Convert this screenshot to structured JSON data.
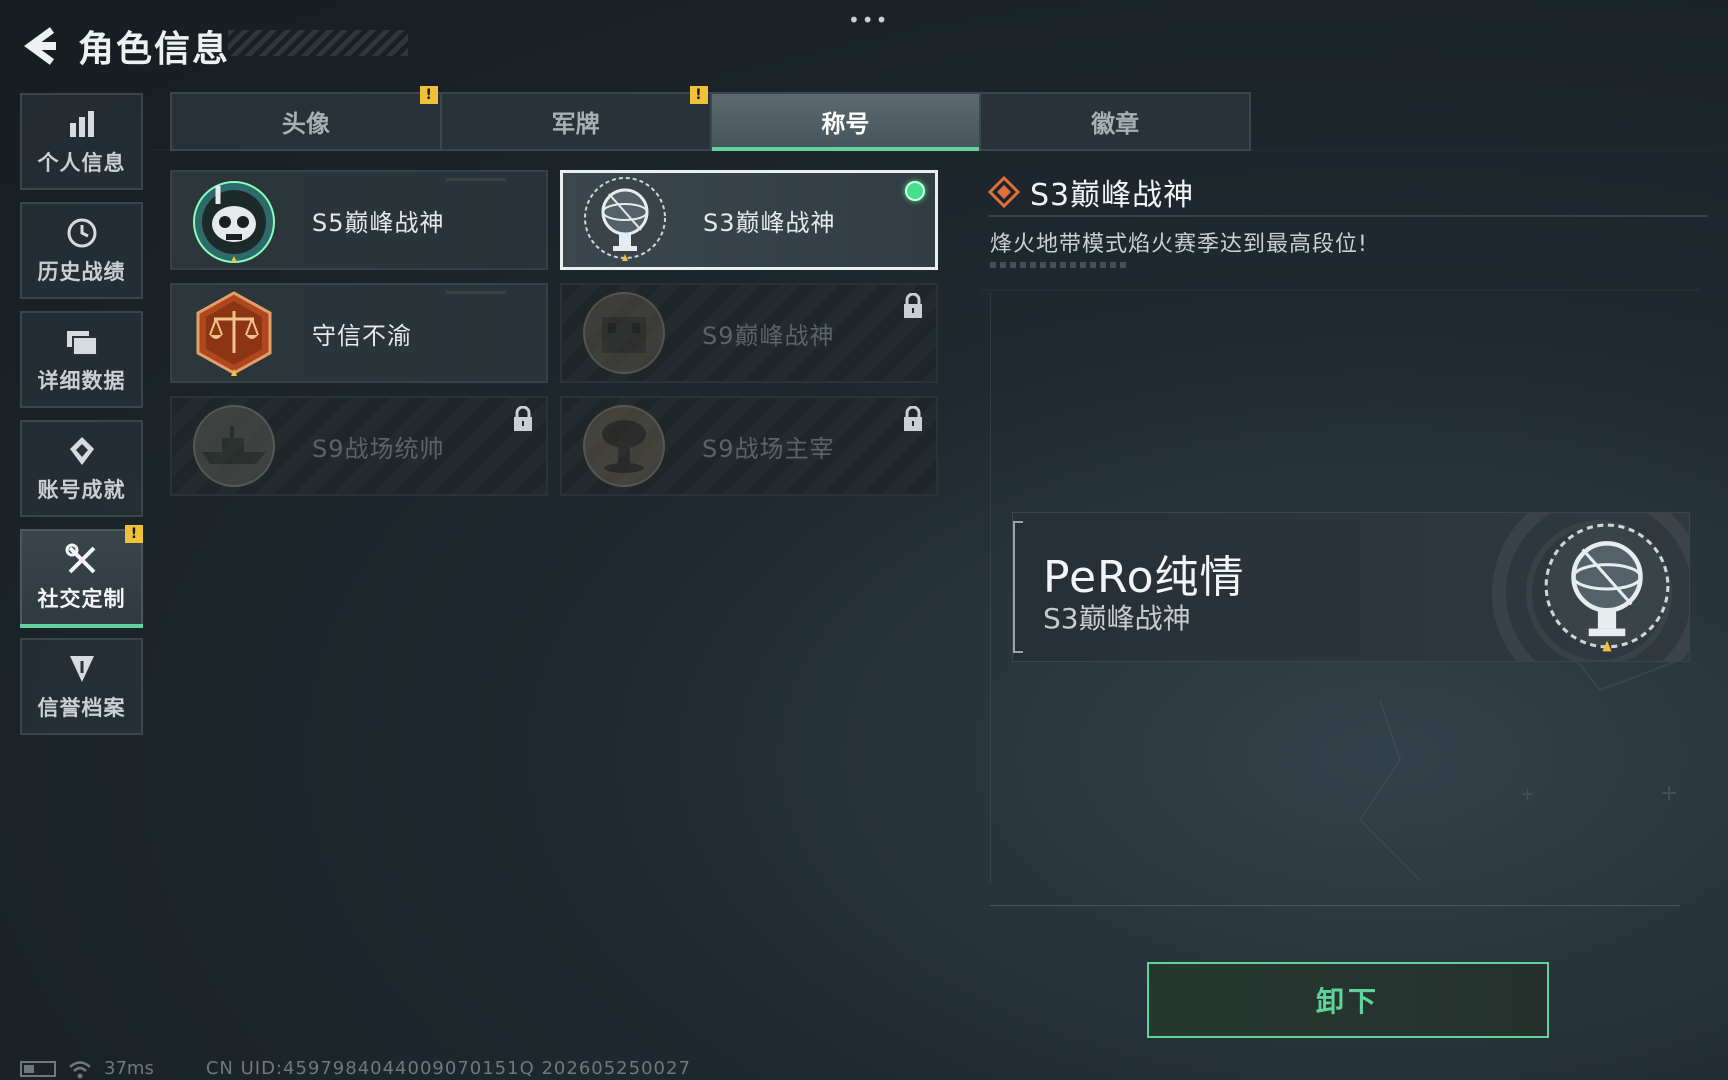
{
  "header": {
    "title": "角色信息",
    "menu_dots": "•••"
  },
  "sidebar": {
    "items": [
      {
        "label": "个人信息",
        "icon": "bar-chart-icon",
        "active": false,
        "warning": false
      },
      {
        "label": "历史战绩",
        "icon": "clock-icon",
        "active": false,
        "warning": false
      },
      {
        "label": "详细数据",
        "icon": "folder-icon",
        "active": false,
        "warning": false
      },
      {
        "label": "账号成就",
        "icon": "medal-icon",
        "active": false,
        "warning": false
      },
      {
        "label": "社交定制",
        "icon": "tools-icon",
        "active": true,
        "warning": true
      },
      {
        "label": "信誉档案",
        "icon": "shield-icon",
        "active": false,
        "warning": false
      }
    ]
  },
  "tabs": [
    {
      "label": "头像",
      "warning": true
    },
    {
      "label": "军牌",
      "warning": true
    },
    {
      "label": "称号",
      "active": true
    },
    {
      "label": "徽章"
    }
  ],
  "titles": [
    {
      "label": "S5巅峰战神",
      "emblem": "diver-skull-emblem",
      "locked": false,
      "selected": false
    },
    {
      "label": "S3巅峰战神",
      "emblem": "armillary-sphere-emblem",
      "locked": false,
      "selected": true,
      "equipped": true
    },
    {
      "label": "守信不渝",
      "emblem": "justice-scale-emblem",
      "locked": false,
      "selected": false
    },
    {
      "label": "S9巅峰战神",
      "emblem": "ruined-building-emblem",
      "locked": true
    },
    {
      "label": "S9战场统帅",
      "emblem": "warship-emblem",
      "locked": true
    },
    {
      "label": "S9战场主宰",
      "emblem": "mushroom-cloud-emblem",
      "locked": true
    }
  ],
  "detail": {
    "title": "S3巅峰战神",
    "description": "烽火地带模式焰火赛季达到最高段位!"
  },
  "preview": {
    "player_name": "PeRo纯情",
    "title": "S3巅峰战神"
  },
  "actions": {
    "unequip": "卸下"
  },
  "status_bar": {
    "ping": "37ms",
    "uid": "CN UID:4597984044009070151Q 202605250027"
  },
  "colors": {
    "accent": "#5fd39a",
    "warning": "#f0c23a",
    "equipped": "#44e08a"
  }
}
